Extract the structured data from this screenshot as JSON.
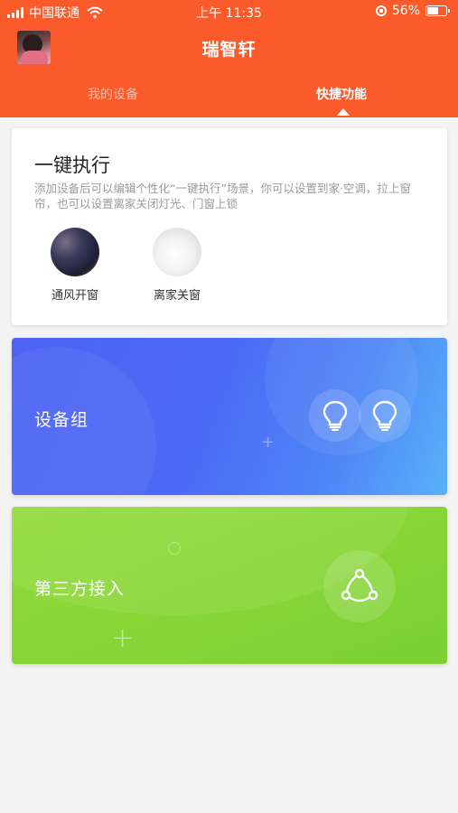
{
  "status_bar": {
    "carrier": "中国联通",
    "time": "上午 11:35",
    "battery": "56%"
  },
  "header": {
    "title": "瑞智轩",
    "tabs": [
      {
        "label": "我的设备",
        "active": false
      },
      {
        "label": "快捷功能",
        "active": true
      }
    ]
  },
  "one_key": {
    "title": "一键执行",
    "description": "添加设备后可以编辑个性化“一键执行”场景，你可以设置到家·空调，拉上窗帘，也可以设置离家关闭灯光、门窗上锁",
    "scenes": [
      {
        "label": "通风开窗",
        "icon": "night-sky-image"
      },
      {
        "label": "离家关窗",
        "icon": "curtain-image"
      }
    ]
  },
  "device_group": {
    "label": "设备组",
    "icons": [
      "lightbulb-icon",
      "lightbulb-icon"
    ]
  },
  "third_party": {
    "label": "第三方接入",
    "icon": "share-icon"
  },
  "colors": {
    "header": "#fb5a2b",
    "group_card": "#4e63f4",
    "third_card": "#8ad738"
  }
}
